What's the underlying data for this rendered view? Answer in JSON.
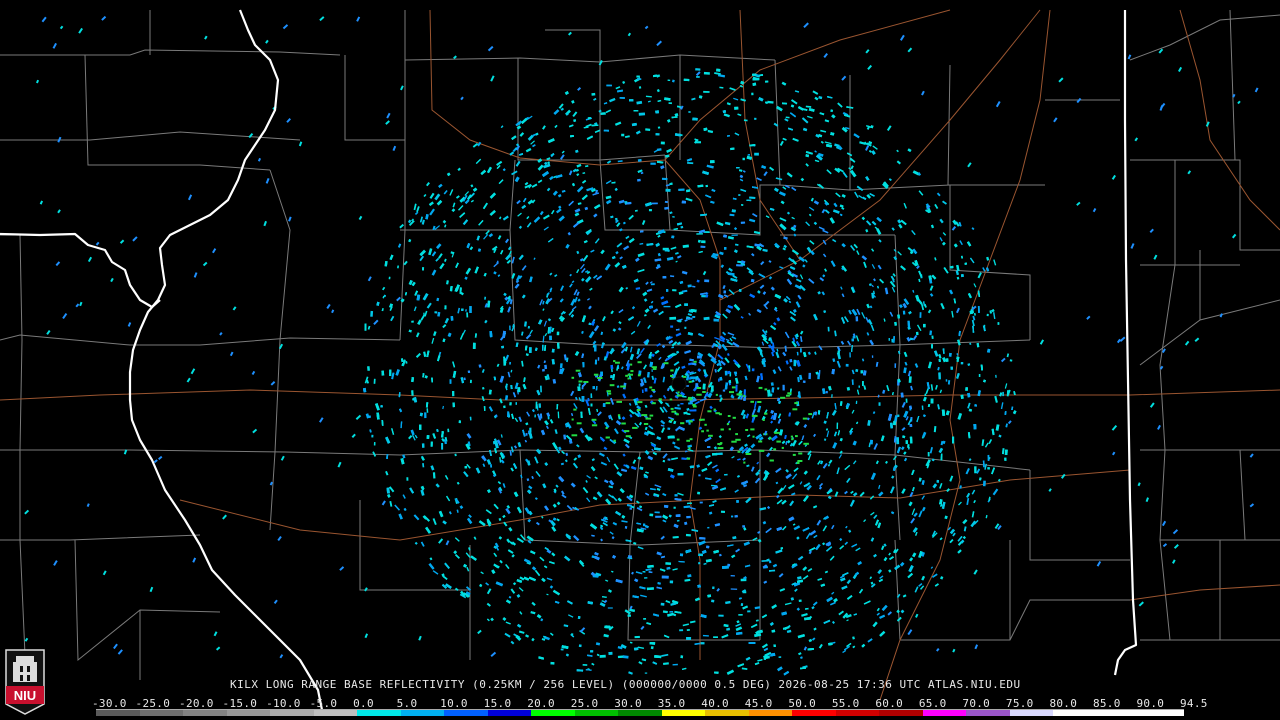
{
  "product": {
    "caption": "KILX LONG RANGE BASE REFLECTIVITY (0.25KM / 256 LEVEL) (000000/0000 0.5 DEG) 2026-08-25 17:36 UTC  ATLAS.NIU.EDU"
  },
  "logo": {
    "text": "NIU",
    "color": "#c8102e"
  },
  "scale": {
    "ticks": [
      "-30.0",
      "-25.0",
      "-20.0",
      "-15.0",
      "-10.0",
      "-5.0",
      "0.0",
      "5.0",
      "10.0",
      "15.0",
      "20.0",
      "25.0",
      "30.0",
      "35.0",
      "40.0",
      "45.0",
      "50.0",
      "55.0",
      "60.0",
      "65.0",
      "70.0",
      "75.0",
      "80.0",
      "85.0",
      "90.0",
      "94.5"
    ],
    "colors": [
      "#5a5a5a",
      "#6e6e6e",
      "#828282",
      "#969696",
      "#aaaaaa",
      "#bebebe",
      "#00e8e8",
      "#00b0f0",
      "#0060ff",
      "#0000d8",
      "#00ff00",
      "#00c000",
      "#008800",
      "#ffff00",
      "#e8c000",
      "#ff9000",
      "#ff0000",
      "#d00000",
      "#b00000",
      "#ff00ff",
      "#9955c9",
      "#d8d8ff",
      "#ffffff",
      "#ffffff",
      "#ffffff"
    ]
  },
  "radar": {
    "site_color": "#000000",
    "echo_colors": [
      "#00e0e0",
      "#00c8e8",
      "#00a8f0",
      "#1e90ff",
      "#0070ff",
      "#40c8c0",
      "#22dd44"
    ]
  },
  "map_colors": {
    "state_border": "#ffffff",
    "county_line": "#7a7a7a",
    "highway": "#9a5530"
  }
}
